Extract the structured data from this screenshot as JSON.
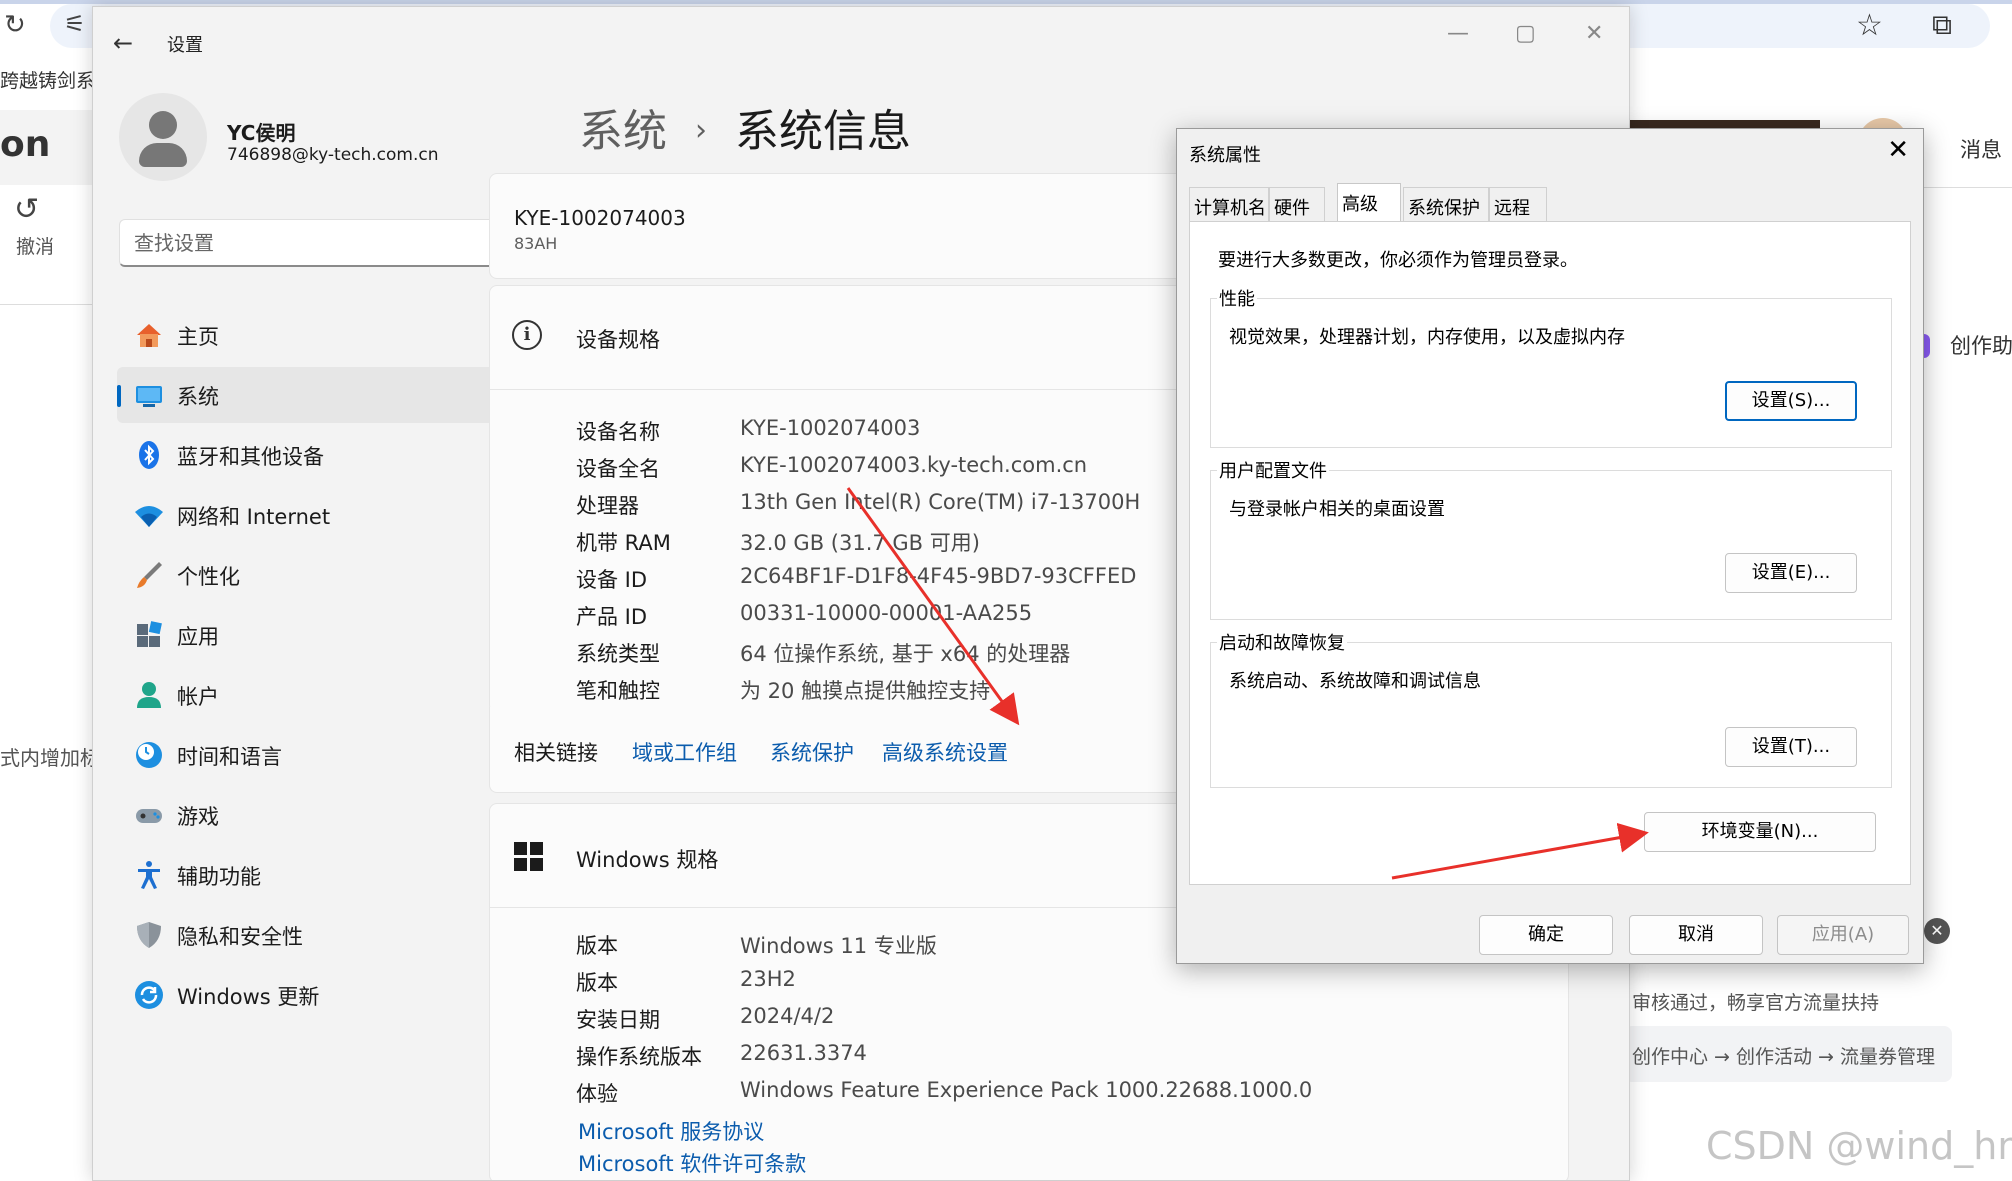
{
  "browser": {
    "reload_icon": "↻",
    "tune_icon": "⚟",
    "star_icon": "☆",
    "extension_icon": "⧉",
    "tab_text": "跨越铸剑系",
    "logo_partial": "on",
    "undo_icon": "↺",
    "undo_label": "撤消",
    "left_text_partial": "式内增加标题",
    "messages": "消息",
    "creator_assistant": "创作助",
    "promo_line1": "审核通过，畅享官方流量扶持",
    "promo_line2": "创作中心 → 创作活动 → 流量券管理",
    "close_glyph": "✕",
    "watermark": "CSDN @wind_hm"
  },
  "settings": {
    "app_title": "设置",
    "back_icon": "←",
    "minimize_icon": "—",
    "maximize_icon": "▢",
    "close_icon": "✕",
    "profile": {
      "name": "YC侯明",
      "email": "746898@ky-tech.com.cn"
    },
    "search": {
      "placeholder": "查找设置",
      "icon": "⌕"
    },
    "nav": [
      {
        "label": "主页",
        "icon": "home-icon",
        "active": false
      },
      {
        "label": "系统",
        "icon": "system-icon",
        "active": true
      },
      {
        "label": "蓝牙和其他设备",
        "icon": "bluetooth-icon",
        "active": false
      },
      {
        "label": "网络和 Internet",
        "icon": "wifi-icon",
        "active": false
      },
      {
        "label": "个性化",
        "icon": "brush-icon",
        "active": false
      },
      {
        "label": "应用",
        "icon": "apps-icon",
        "active": false
      },
      {
        "label": "帐户",
        "icon": "account-icon",
        "active": false
      },
      {
        "label": "时间和语言",
        "icon": "time-language-icon",
        "active": false
      },
      {
        "label": "游戏",
        "icon": "gaming-icon",
        "active": false
      },
      {
        "label": "辅助功能",
        "icon": "accessibility-icon",
        "active": false
      },
      {
        "label": "隐私和安全性",
        "icon": "shield-icon",
        "active": false
      },
      {
        "label": "Windows 更新",
        "icon": "update-icon",
        "active": false
      }
    ],
    "breadcrumb": {
      "parent": "系统",
      "separator": "›",
      "current": "系统信息"
    },
    "device": {
      "name": "KYE-1002074003",
      "model": "83AH"
    },
    "device_specs": {
      "title": "设备规格",
      "info_icon": "i",
      "rows": [
        {
          "key": "设备名称",
          "value": "KYE-1002074003"
        },
        {
          "key": "设备全名",
          "value": "KYE-1002074003.ky-tech.com.cn"
        },
        {
          "key": "处理器",
          "value": "13th Gen Intel(R) Core(TM) i7-13700H"
        },
        {
          "key": "机带 RAM",
          "value": "32.0 GB (31.7 GB 可用)"
        },
        {
          "key": "设备 ID",
          "value": "2C64BF1F-D1F8-4F45-9BD7-93CFFED"
        },
        {
          "key": "产品 ID",
          "value": "00331-10000-00001-AA255"
        },
        {
          "key": "系统类型",
          "value": "64 位操作系统, 基于 x64 的处理器"
        },
        {
          "key": "笔和触控",
          "value": "为 20 触摸点提供触控支持"
        }
      ]
    },
    "related_links": {
      "label": "相关链接",
      "links": [
        "域或工作组",
        "系统保护",
        "高级系统设置"
      ]
    },
    "windows_specs": {
      "title": "Windows 规格",
      "rows": [
        {
          "key": "版本",
          "value": "Windows 11 专业版"
        },
        {
          "key": "版本",
          "value": "23H2"
        },
        {
          "key": "安装日期",
          "value": "2024/4/2"
        },
        {
          "key": "操作系统版本",
          "value": "22631.3374"
        },
        {
          "key": "体验",
          "value": "Windows Feature Experience Pack 1000.22688.1000.0"
        }
      ],
      "links": [
        "Microsoft 服务协议",
        "Microsoft 软件许可条款"
      ]
    }
  },
  "dialog": {
    "title": "系统属性",
    "close_icon": "✕",
    "tabs": [
      "计算机名",
      "硬件",
      "高级",
      "系统保护",
      "远程"
    ],
    "active_tab": "高级",
    "admin_note": "要进行大多数更改，你必须作为管理员登录。",
    "performance": {
      "label": "性能",
      "desc": "视觉效果，处理器计划，内存使用，以及虚拟内存",
      "button": "设置(S)..."
    },
    "user_profiles": {
      "label": "用户配置文件",
      "desc": "与登录帐户相关的桌面设置",
      "button": "设置(E)..."
    },
    "startup_recovery": {
      "label": "启动和故障恢复",
      "desc": "系统启动、系统故障和调试信息",
      "button": "设置(T)..."
    },
    "env_button": "环境变量(N)...",
    "ok": "确定",
    "cancel": "取消",
    "apply": "应用(A)"
  },
  "colors": {
    "accent": "#0067c0",
    "link": "#0b5cad",
    "annotation_arrow": "#e8302a"
  }
}
